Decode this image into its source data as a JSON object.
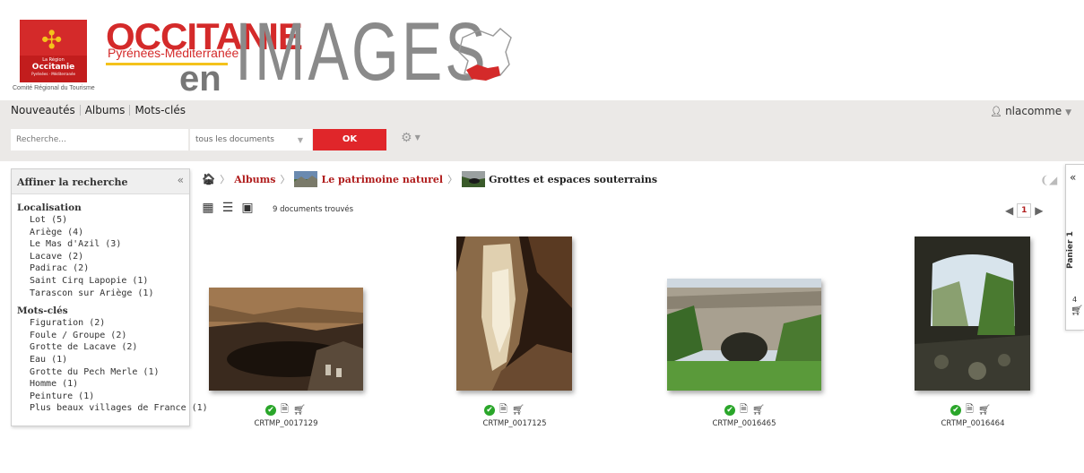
{
  "header": {
    "emblem": {
      "line1": "La Région",
      "line2": "Occitanie",
      "line3": "Pyrénées · Méditerranée"
    },
    "crt_label": "Comité Régional du Tourisme",
    "brand_main": "OCCITANIE",
    "brand_sub": "Pyrénées-Méditerranée",
    "brand_en": "en",
    "brand_images": "IMAGES",
    "colors": {
      "brand_red": "#d42a2a",
      "brand_yellow": "#f4c21b",
      "grey": "#8a8a8a"
    }
  },
  "nav": {
    "links": [
      "Nouveautés",
      "Albums",
      "Mots-clés"
    ],
    "user": "nlacomme"
  },
  "search": {
    "placeholder": "Recherche...",
    "scope": "tous les documents",
    "ok_label": "OK"
  },
  "sidebar": {
    "title": "Affiner la recherche",
    "collapse": "«",
    "facets": [
      {
        "title": "Localisation",
        "items": [
          "Lot (5)",
          "Ariège (4)",
          "Le Mas d'Azil (3)",
          "Lacave (2)",
          "Padirac (2)",
          "Saint Cirq Lapopie (1)",
          "Tarascon sur Ariège (1)"
        ]
      },
      {
        "title": "Mots-clés",
        "items": [
          "Figuration (2)",
          "Foule / Groupe (2)",
          "Grotte de Lacave (2)",
          "Eau (1)",
          "Grotte du Pech Merle (1)",
          "Homme (1)",
          "Peinture (1)",
          "Plus beaux villages de France (1)"
        ]
      }
    ]
  },
  "breadcrumb": {
    "albums": "Albums",
    "album": "Le patrimoine naturel",
    "current": "Grottes et espaces souterrains"
  },
  "results": {
    "count_label": "9 documents trouvés",
    "page": "1"
  },
  "cart": {
    "label": "Panier 1",
    "count": "4",
    "collapse": "«"
  },
  "documents": [
    {
      "id": "CRTMP_0017129"
    },
    {
      "id": "CRTMP_0017125"
    },
    {
      "id": "CRTMP_0016465"
    },
    {
      "id": "CRTMP_0016464"
    }
  ]
}
